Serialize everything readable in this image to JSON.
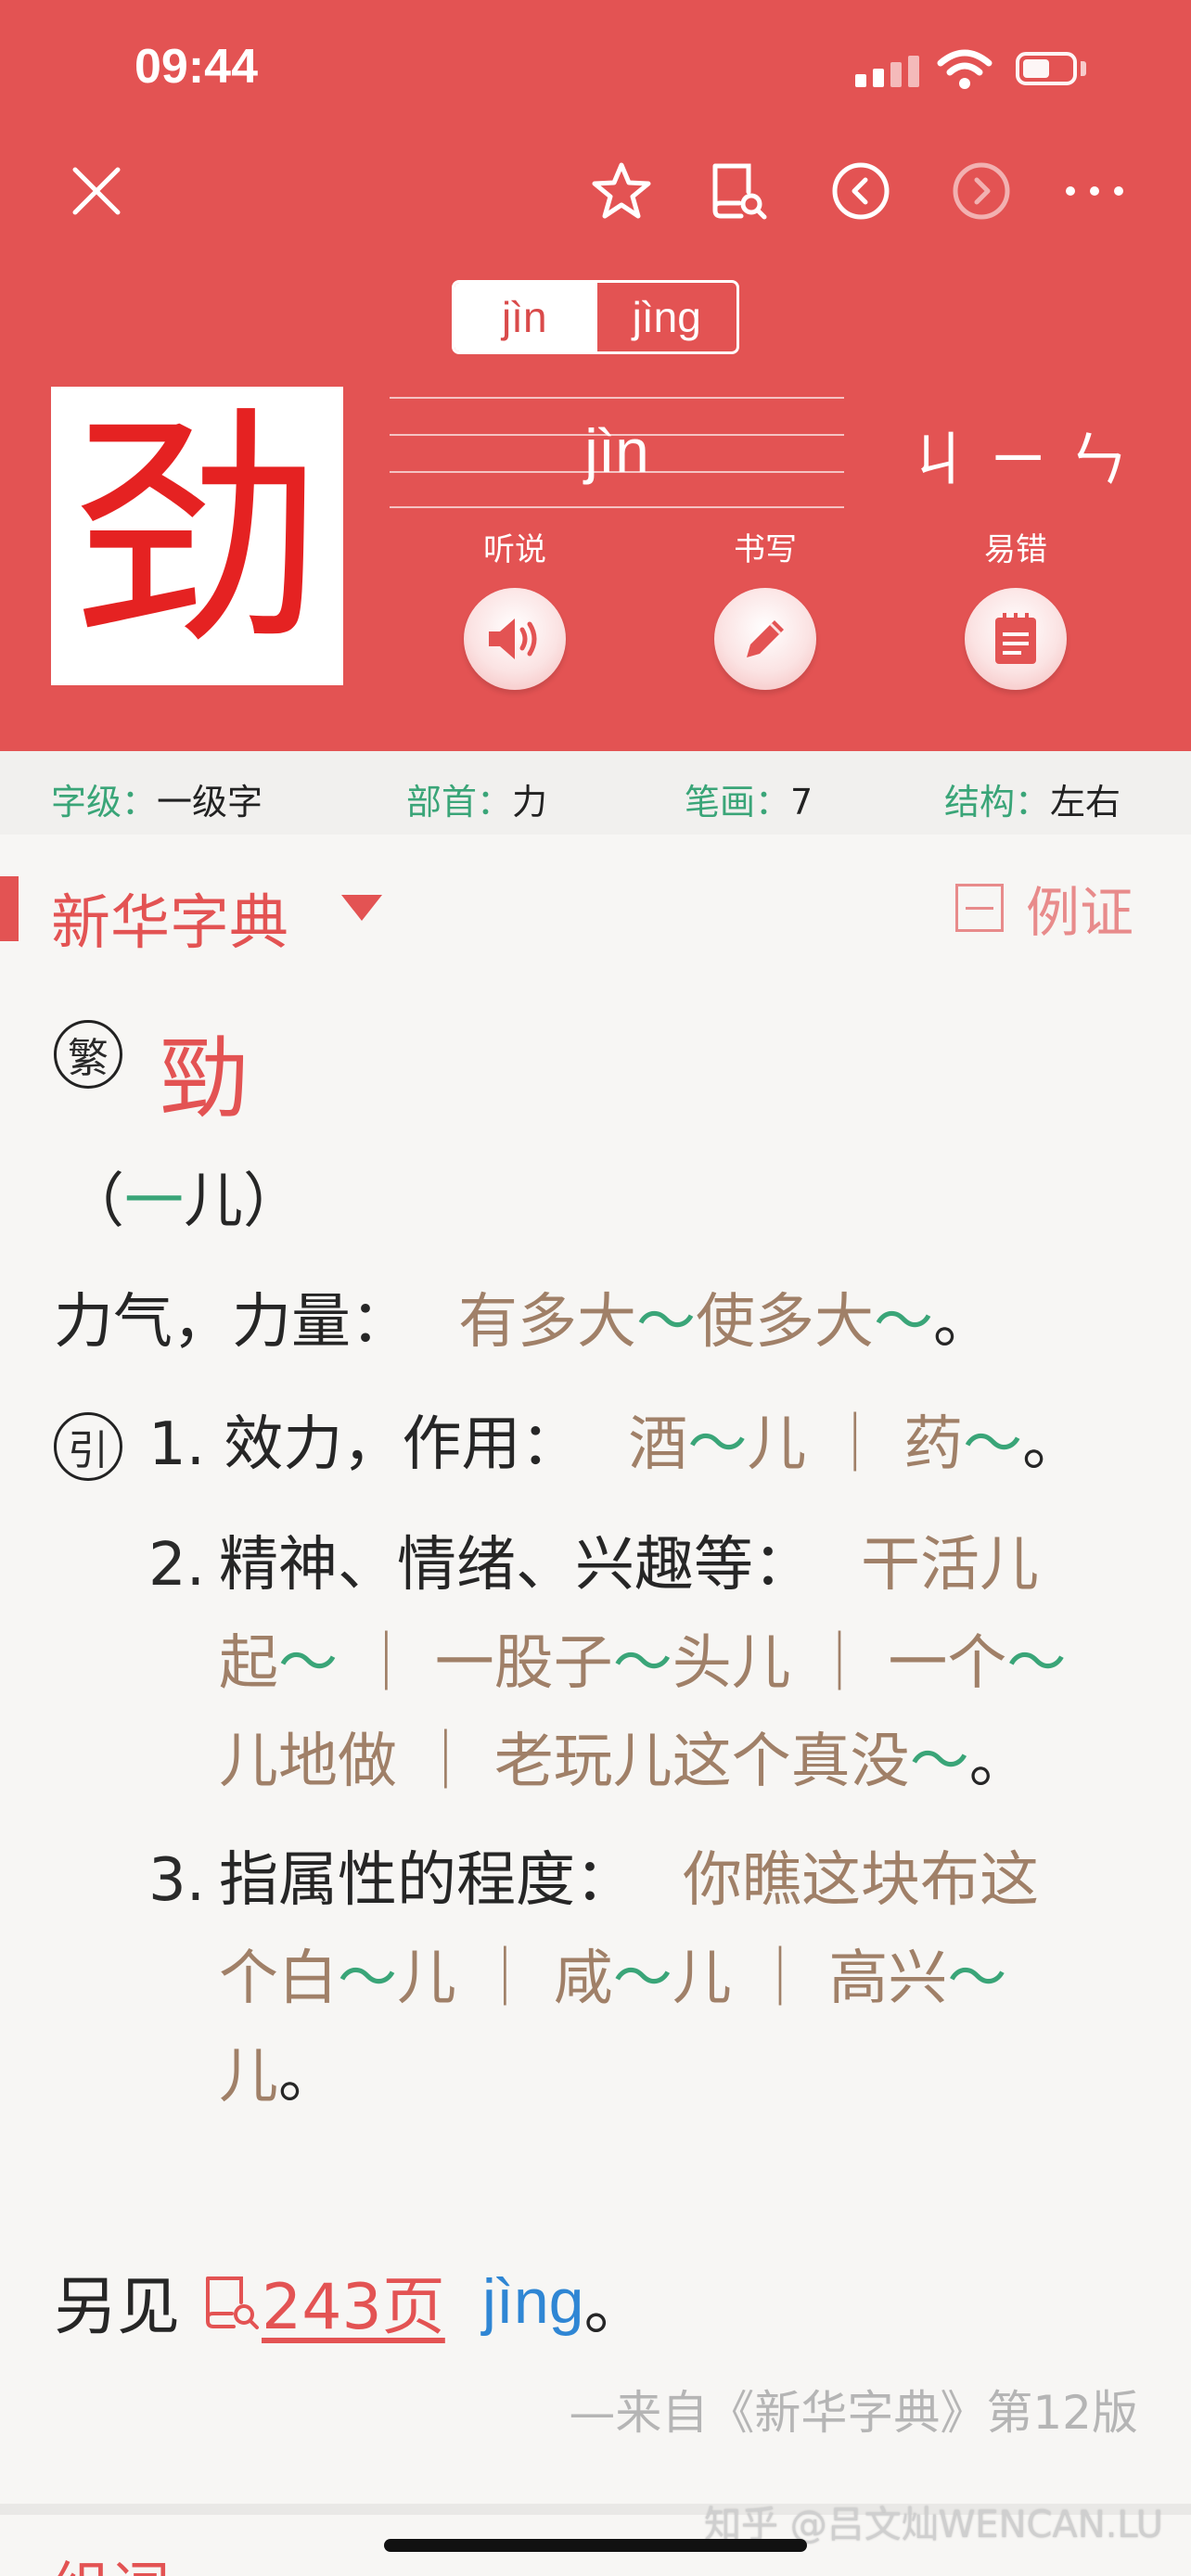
{
  "status_bar": {
    "time": "09:44"
  },
  "header": {
    "pinyin_tabs": [
      "jìn",
      "jìng"
    ],
    "character": "劲",
    "pinyin": "jìn",
    "bopomofo": "ㄐㄧㄣ",
    "actions": {
      "listen": "听说",
      "write": "书写",
      "mistakes": "易错"
    }
  },
  "info": {
    "level_key": "字级",
    "level_val": "一级字",
    "radical_key": "部首",
    "radical_val": "力",
    "strokes_key": "笔画",
    "strokes_val": "7",
    "structure_key": "结构",
    "structure_val": "左右"
  },
  "dictionary": {
    "title": "新华字典",
    "example_label": "例证",
    "traditional_mark": "繁",
    "traditional_char": "勁",
    "er_line": {
      "open": "（",
      "dash": "一",
      "er": "儿）"
    },
    "def0": {
      "text": "力气，力量：",
      "ex1": "有多大",
      "t": "～",
      "ex2": "使多大",
      "end": "。"
    },
    "yin_mark": "引",
    "def1": {
      "num": "1.",
      "text": "效力，作用：",
      "ex": "酒",
      "er": "儿",
      "sep": "｜",
      "ex2": "药",
      "end": "。"
    },
    "def2": {
      "num": "2.",
      "text": "精神、情绪、兴趣等：",
      "a": "干活儿",
      "b": "起",
      "c": "一股子",
      "d": "头儿",
      "e": "一个",
      "f": "儿地做",
      "g": "老玩儿这个真没"
    },
    "def3": {
      "num": "3.",
      "text": "指属性的程度：",
      "a": "你瞧这块布这",
      "b": "个白",
      "c": "咸",
      "d": "高兴",
      "e": "儿",
      "end": "。"
    },
    "see_also": {
      "label": "另见",
      "page": "243页",
      "pinyin": "jìng",
      "end": "。"
    },
    "source": "—来自《新华字典》第12版",
    "next_section": "组词"
  },
  "watermark": "知乎 @吕文灿WENCAN.LU"
}
